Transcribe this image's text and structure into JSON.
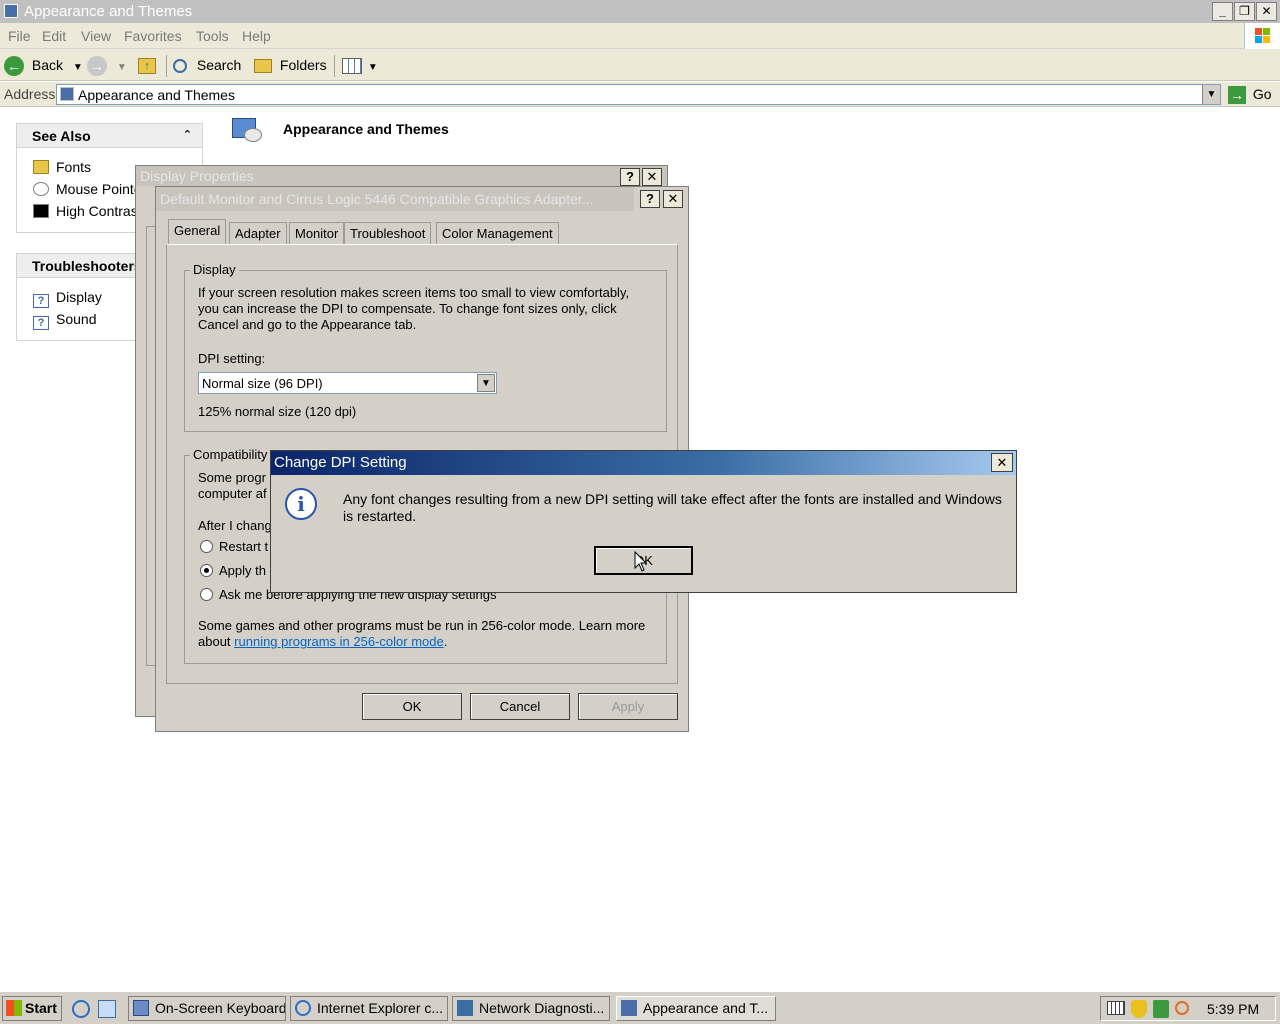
{
  "window": {
    "title": "Appearance and Themes"
  },
  "menu": [
    "File",
    "Edit",
    "View",
    "Favorites",
    "Tools",
    "Help"
  ],
  "toolbar": {
    "back": "Back",
    "search": "Search",
    "folders": "Folders"
  },
  "address": {
    "label": "Address",
    "value": "Appearance and Themes",
    "go": "Go"
  },
  "see_also": {
    "title": "See Also",
    "items": [
      "Fonts",
      "Mouse Pointers",
      "High Contrast"
    ]
  },
  "troubleshooters": {
    "title": "Troubleshooters",
    "items": [
      "Display",
      "Sound"
    ]
  },
  "main": {
    "heading": "Appearance and Themes"
  },
  "display_properties": {
    "title": "Display Properties"
  },
  "adapter_dialog": {
    "title": "Default Monitor and Cirrus Logic 5446 Compatible Graphics Adapter...",
    "tabs": [
      "General",
      "Adapter",
      "Monitor",
      "Troubleshoot",
      "Color Management"
    ],
    "display_group": "Display",
    "display_text": "If your screen resolution makes screen items too small to view comfortably, you can increase the DPI to compensate.  To change font sizes only, click Cancel and go to the Appearance tab.",
    "dpi_label": "DPI setting:",
    "dpi_value": "Normal size (96 DPI)",
    "dpi_note": "125% normal size (120 dpi)",
    "compat_group": "Compatibility",
    "compat_text_1": "Some progr",
    "compat_text_2": "computer af",
    "after_label": "After I chang",
    "radio_restart": "Restart t",
    "radio_apply": "Apply th",
    "radio_ask": "Ask me before applying the new display settings",
    "games_text": "Some games and other programs must be run in 256-color mode.  Learn more about",
    "games_link": "running programs in 256-color mode",
    "ok": "OK",
    "cancel": "Cancel",
    "apply": "Apply"
  },
  "dpi_dialog": {
    "title": "Change DPI Setting",
    "message": "Any font changes resulting from a new DPI setting will take effect after the fonts are installed and Windows is restarted.",
    "ok": "OK"
  },
  "taskbar": {
    "start": "Start",
    "tasks": [
      "On-Screen Keyboard",
      "Internet Explorer c...",
      "Network Diagnosti...",
      "Appearance and T..."
    ],
    "clock": "5:39 PM"
  },
  "colors": {
    "title_active_start": "#0a246a",
    "title_active_end": "#a6caf0",
    "face": "#d4d0c8",
    "link": "#0066cc"
  }
}
